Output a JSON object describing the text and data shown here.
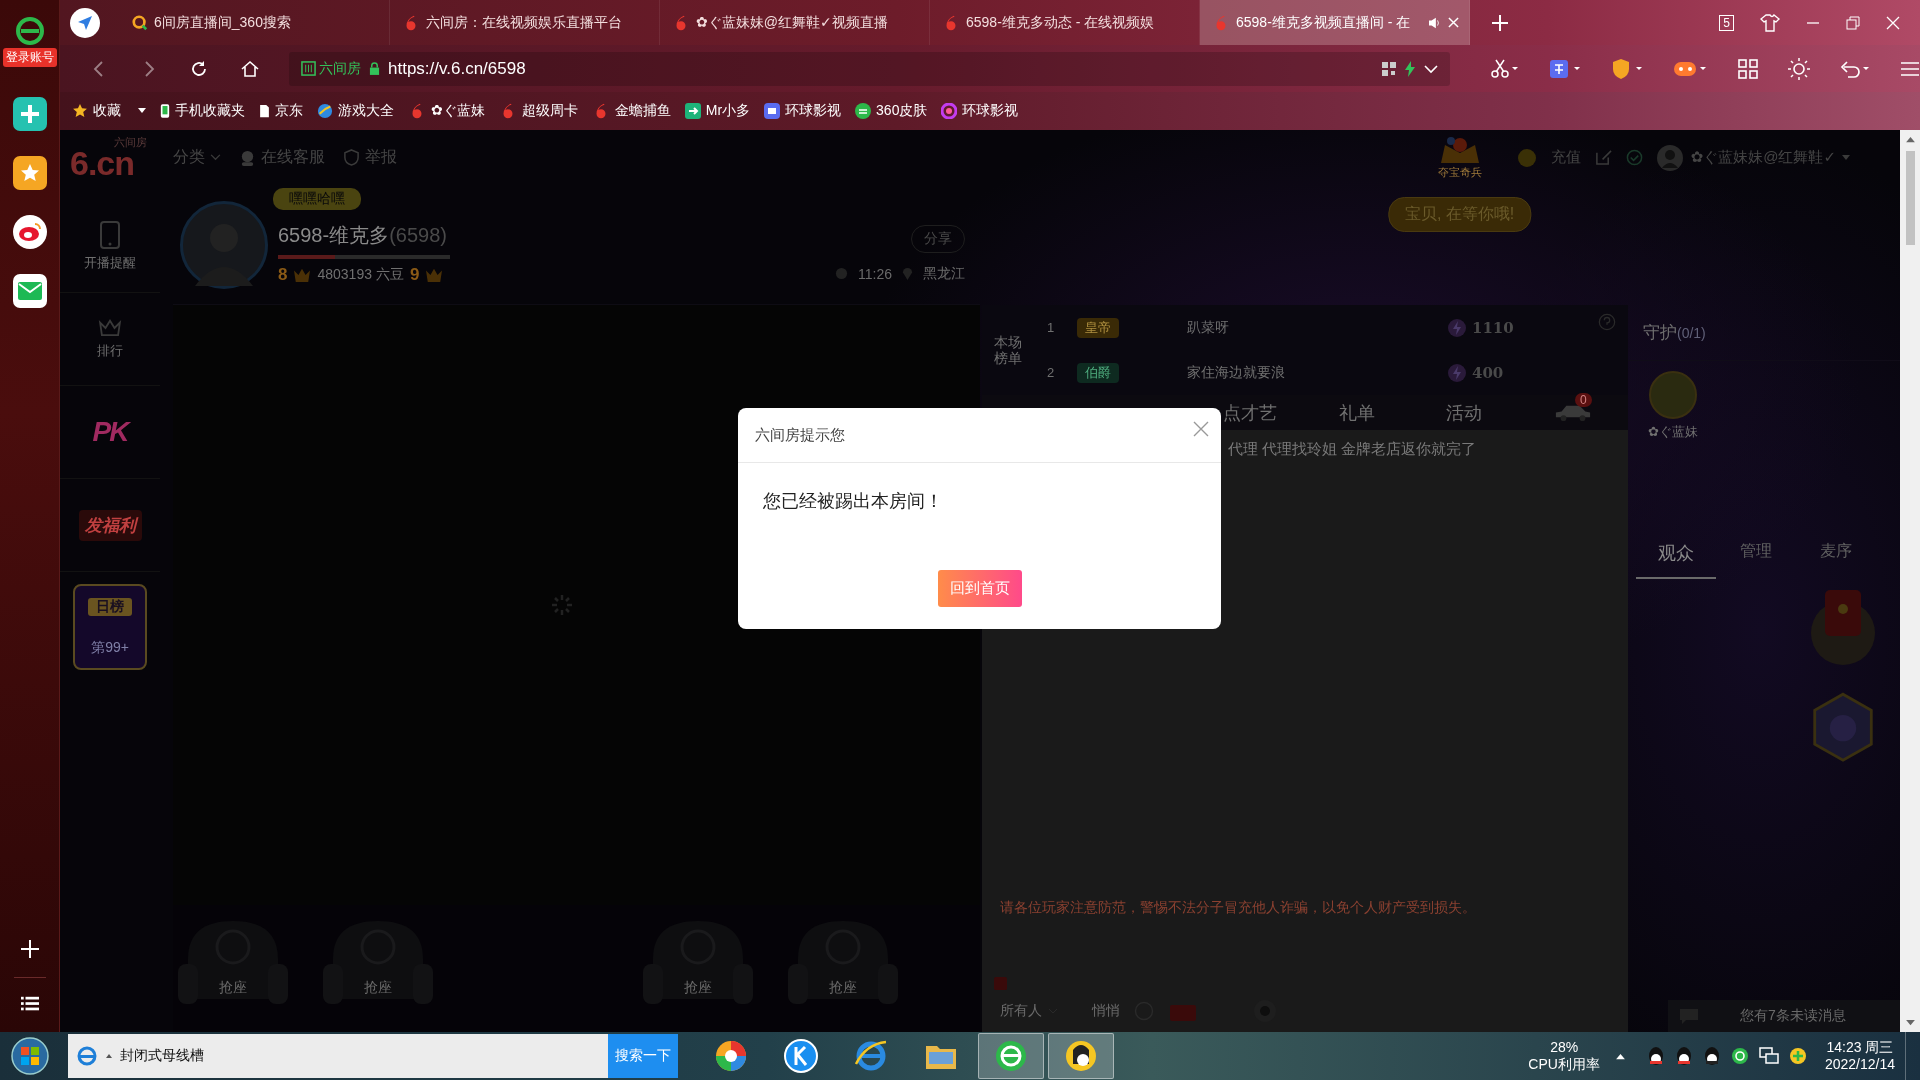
{
  "browser_sidebar": {
    "account_button": "登录账号"
  },
  "tabs": [
    {
      "title": "6间房直播间_360搜索",
      "selected": false
    },
    {
      "title": "六间房：在线视频娱乐直播平台",
      "selected": false
    },
    {
      "title": "✿ぐ蓝妹妹@红舞鞋✓视频直播",
      "selected": false
    },
    {
      "title": "6598-维克多动态 - 在线视频娱",
      "selected": false
    },
    {
      "title": "6598-维克多视频直播间 - 在",
      "selected": true
    }
  ],
  "tab_counter": "5",
  "address_bar": {
    "site_label": "六间房",
    "url": "https://v.6.cn/6598"
  },
  "bookmarks": [
    {
      "label": "收藏"
    },
    {
      "label": "手机收藏夹"
    },
    {
      "label": "京东"
    },
    {
      "label": "游戏大全"
    },
    {
      "label": "✿ぐ蓝妹"
    },
    {
      "label": "超级周卡"
    },
    {
      "label": "金蟾捕鱼"
    },
    {
      "label": "Mr小多"
    },
    {
      "label": "环球影视"
    },
    {
      "label": "360皮肤"
    },
    {
      "label": "环球影视"
    }
  ],
  "page": {
    "header": {
      "logo": "6.cn",
      "logo_caption": "六间房",
      "nav": [
        {
          "label": "分类"
        },
        {
          "label": "在线客服"
        },
        {
          "label": "举报"
        }
      ],
      "game_label": "夺宝奇兵",
      "game_bubble": "宝贝, 在等你哦!",
      "recharge": "充值",
      "username": "✿ぐ蓝妹妹@红舞鞋✓"
    },
    "side_nav": [
      {
        "label": "开播提醒",
        "kind": "phone"
      },
      {
        "label": "排行",
        "kind": "crown"
      },
      {
        "label": "PK",
        "kind": "logo"
      },
      {
        "label": "发福利",
        "kind": "logo"
      }
    ],
    "daily_rank": {
      "title": "日榜",
      "rank": "第99+"
    },
    "anchor": {
      "bubble": "嘿嘿哈嘿",
      "name": "6598-维克多",
      "room_id": "(6598)",
      "level": 0.33,
      "left_rank": "8",
      "beans": "4803193 六豆",
      "right_rank": "9",
      "share": "分享",
      "time": "11:26",
      "location": "黑龙江"
    },
    "seats": [
      {
        "label": "抢座"
      },
      {
        "label": "抢座"
      },
      {
        "label": "抢座"
      },
      {
        "label": "抢座"
      }
    ],
    "ranking": {
      "title": "本场榜单",
      "entries": [
        {
          "rank": "1",
          "badge": "皇帝",
          "name": "趴菜呀",
          "score": "1110"
        },
        {
          "rank": "2",
          "badge": "伯爵",
          "name": "家住海边就要浪",
          "score": "400"
        }
      ]
    },
    "chat_tabs": [
      {
        "label": "点才艺"
      },
      {
        "label": "礼单"
      },
      {
        "label": "活动"
      }
    ],
    "car_badge": "0",
    "chat": {
      "messages": [
        "代理 代理找玲姐 金牌老店返你就完了"
      ],
      "notice": "请各位玩家注意防范，警惕不法分子冒充他人诈骗，以免个人财产受到损失。",
      "target": "所有人",
      "whisper": "悄悄"
    },
    "guard": {
      "title": "守护",
      "count": "(0/1)",
      "member": "✿ぐ蓝妹"
    },
    "audience_tabs": [
      {
        "label": "观众",
        "selected": true
      },
      {
        "label": "管理",
        "selected": false
      },
      {
        "label": "麦序",
        "selected": false
      }
    ],
    "unread": "您有7条未读消息"
  },
  "dialog": {
    "title": "六间房提示您",
    "message": "您已经被踢出本房间！",
    "button": "回到首页"
  },
  "taskbar": {
    "search": "封闭式母线槽",
    "search_button": "搜索一下",
    "apps": [
      {
        "selected": false
      },
      {
        "selected": false
      },
      {
        "selected": false
      },
      {
        "selected": false
      },
      {
        "selected": true
      },
      {
        "selected": true
      }
    ],
    "cpu": "28%",
    "cpu_label": "CPU利用率",
    "time": "14:23 周三",
    "date": "2022/12/14"
  }
}
